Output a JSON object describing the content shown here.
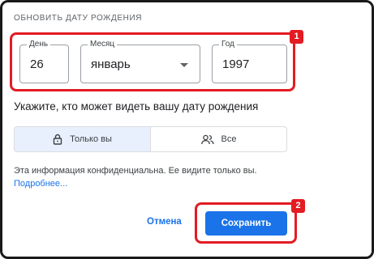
{
  "section": {
    "title": "ОБНОВИТЬ ДАТУ РОЖДЕНИЯ"
  },
  "fields": {
    "day": {
      "label": "День",
      "value": "26"
    },
    "month": {
      "label": "Месяц",
      "value": "январь"
    },
    "year": {
      "label": "Год",
      "value": "1997"
    }
  },
  "visibility": {
    "prompt": "Укажите, кто может видеть вашу дату рождения",
    "options": [
      {
        "label": "Только вы",
        "icon": "lock-icon",
        "selected": true
      },
      {
        "label": "Все",
        "icon": "people-icon",
        "selected": false
      }
    ]
  },
  "info": {
    "text": "Эта информация конфиденциальна. Ее видите только вы.",
    "link": "Подробнее..."
  },
  "actions": {
    "cancel": "Отмена",
    "save": "Сохранить"
  },
  "annotations": {
    "badge1": "1",
    "badge2": "2"
  },
  "colors": {
    "accent": "#1a73e8",
    "highlight": "#e31b23",
    "selected_bg": "#e8f0fe"
  }
}
